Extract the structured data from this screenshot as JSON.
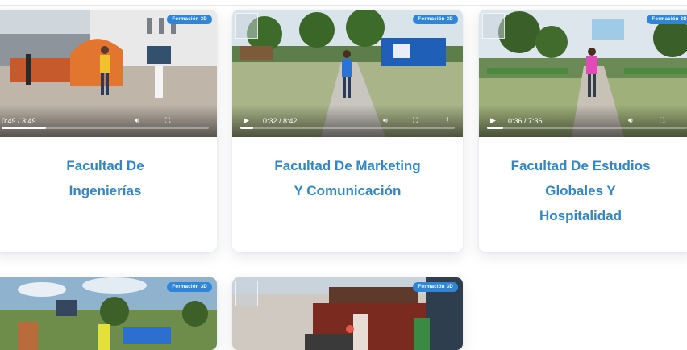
{
  "badge_text": "Formación 3D",
  "cards": [
    {
      "title_lines": [
        "Facultad De",
        "Ingenierías"
      ],
      "time": "0:49 / 3:49",
      "progress": 0.214
    },
    {
      "title_lines": [
        "Facultad De Marketing",
        "Y Comunicación"
      ],
      "time": "0:32 / 8:42",
      "progress": 0.061
    },
    {
      "title_lines": [
        "Facultad De Estudios",
        "Globales Y",
        "Hospitalidad"
      ],
      "time": "0:36 / 7:36",
      "progress": 0.079
    }
  ],
  "colors": {
    "title": "#2f86c9",
    "badge": "#2f86d8"
  },
  "icons": [
    "play-icon",
    "volume-icon",
    "fullscreen-icon",
    "more-options-icon"
  ]
}
